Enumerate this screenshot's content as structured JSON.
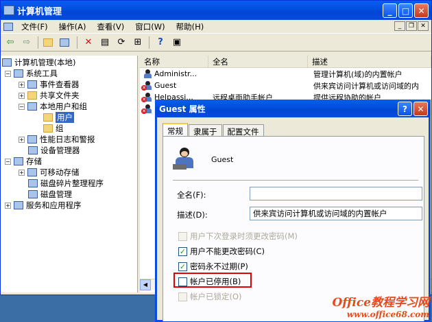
{
  "window": {
    "title": "计算机管理"
  },
  "menu": [
    "文件(F)",
    "操作(A)",
    "查看(V)",
    "窗口(W)",
    "帮助(H)"
  ],
  "tree": {
    "root": "计算机管理(本地)",
    "system_tools": "系统工具",
    "event_viewer": "事件查看器",
    "shared_folders": "共享文件夹",
    "local_users": "本地用户和组",
    "users": "用户",
    "groups": "组",
    "perf_logs": "性能日志和警报",
    "device_manager": "设备管理器",
    "storage": "存储",
    "removable": "可移动存储",
    "defrag": "磁盘碎片整理程序",
    "disk_mgmt": "磁盘管理",
    "services": "服务和应用程序"
  },
  "list": {
    "headers": [
      "名称",
      "全名",
      "描述"
    ],
    "rows": [
      {
        "name": "Administr...",
        "full": "",
        "desc": "管理计算机(域)的内置帐户"
      },
      {
        "name": "Guest",
        "full": "",
        "desc": "供来宾访问计算机或访问域的内"
      },
      {
        "name": "Helpassi...",
        "full": "远程桌面助手帐户",
        "desc": "提供远程协助的帐户"
      }
    ]
  },
  "dialog": {
    "title": "Guest 属性",
    "tabs": [
      "常规",
      "隶属于",
      "配置文件"
    ],
    "username": "Guest",
    "fullname_label": "全名(F):",
    "fullname_value": "",
    "desc_label": "描述(D):",
    "desc_value": "供来宾访问计算机或访问域的内置帐户",
    "checkboxes": [
      {
        "label": "用户下次登录时须更改密码(M)",
        "checked": false,
        "disabled": true
      },
      {
        "label": "用户不能更改密码(C)",
        "checked": true,
        "disabled": false
      },
      {
        "label": "密码永不过期(P)",
        "checked": true,
        "disabled": false
      },
      {
        "label": "帐户已停用(B)",
        "checked": false,
        "disabled": false
      },
      {
        "label": "帐户已锁定(O)",
        "checked": false,
        "disabled": true
      }
    ]
  },
  "watermark": {
    "line1": "Office教程学习网",
    "line2": "www.office68.com"
  },
  "colors": {
    "title_bar": "#0350df",
    "highlight": "#e00000",
    "selection": "#316ac5"
  }
}
